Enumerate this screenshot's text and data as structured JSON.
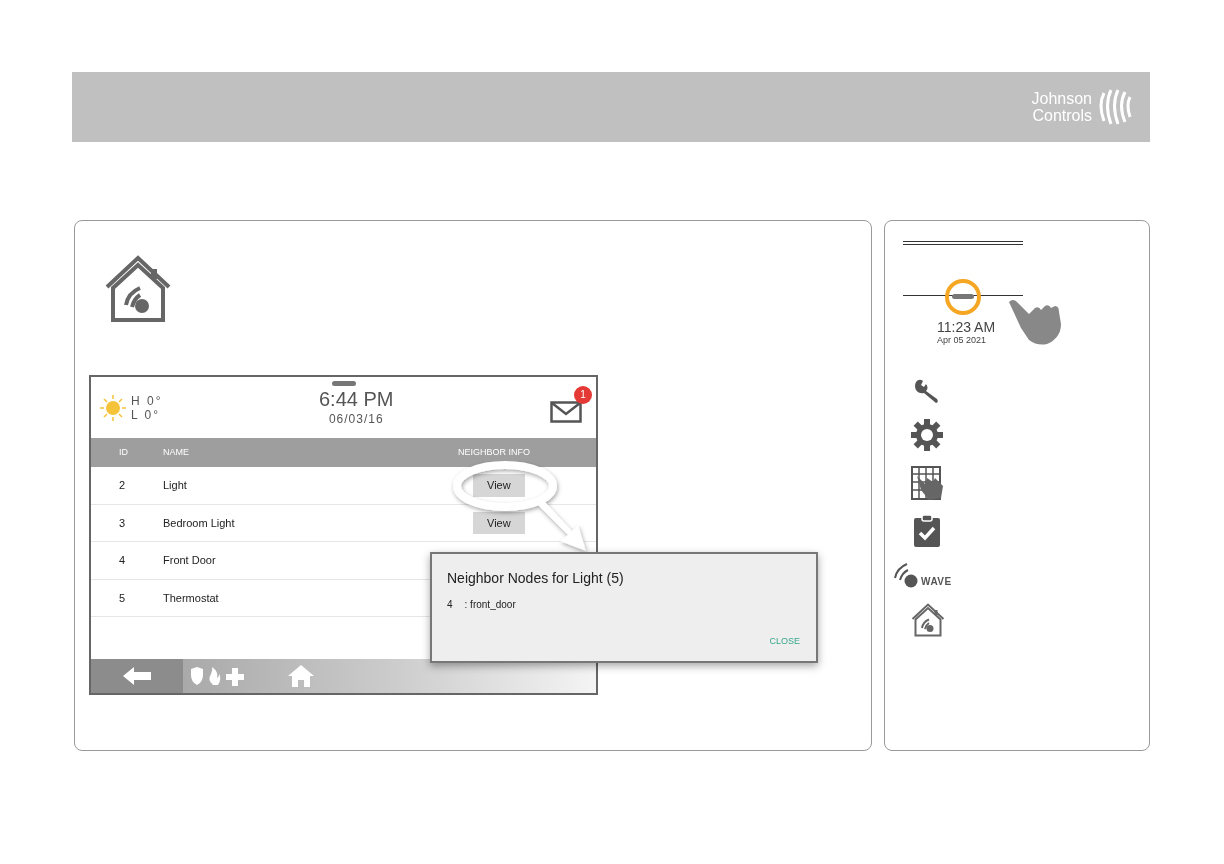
{
  "header": {
    "logo_lines": [
      "Johnson",
      "Controls"
    ]
  },
  "device_screen": {
    "weather": {
      "high": "H 0°",
      "low": "L 0°"
    },
    "time": "6:44 PM",
    "date": "06/03/16",
    "mail_badge": "1",
    "table": {
      "columns": [
        "ID",
        "NAME",
        "NEIGHBOR INFO"
      ],
      "rows": [
        {
          "id": "2",
          "name": "Light",
          "action": "View"
        },
        {
          "id": "3",
          "name": "Bedroom Light",
          "action": "View"
        },
        {
          "id": "4",
          "name": "Front Door"
        },
        {
          "id": "5",
          "name": "Thermostat"
        }
      ]
    },
    "dialog": {
      "title": "Neighbor Nodes for Light (5)",
      "items": [
        {
          "id": "4",
          "name": ": front_door"
        }
      ],
      "button": "CLOSE"
    }
  },
  "sidebar": {
    "time": "11:23 AM",
    "date": "Apr 05 2021",
    "zwave_label": "WAVE"
  }
}
